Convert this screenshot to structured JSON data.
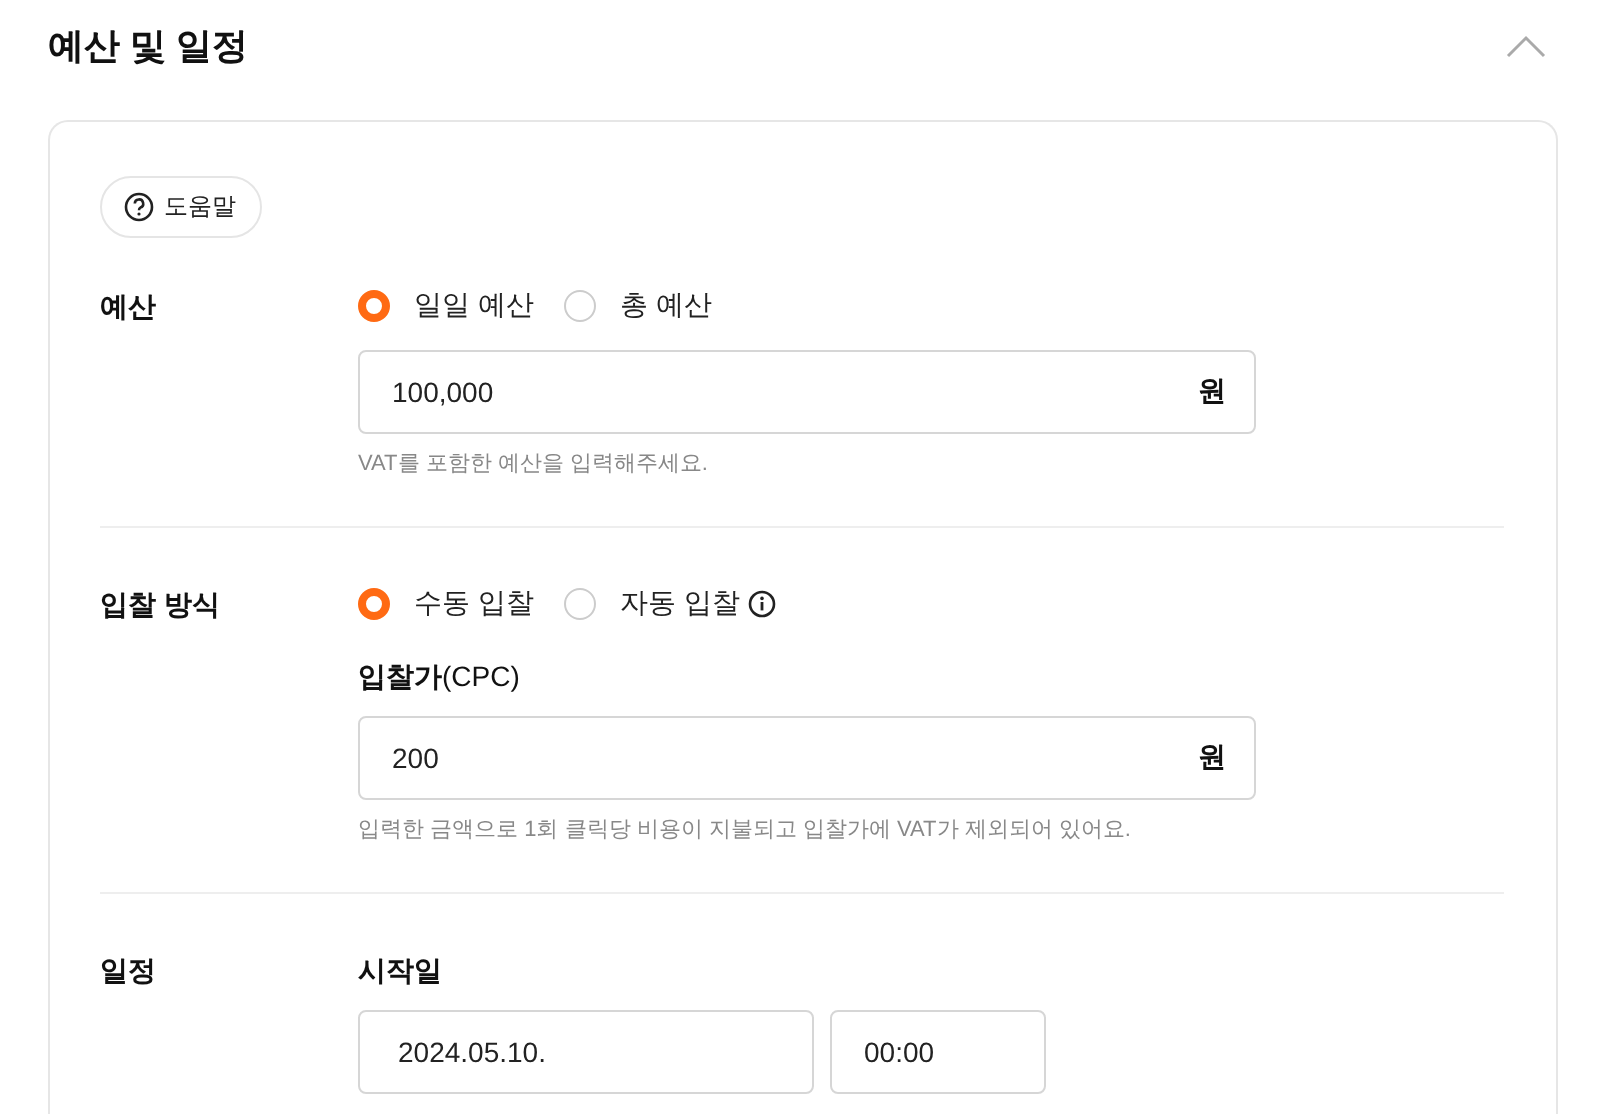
{
  "section": {
    "title": "예산 및 일정",
    "expanded": true
  },
  "help_button": {
    "label": "도움말"
  },
  "budget": {
    "label": "예산",
    "options": [
      {
        "label": "일일 예산",
        "selected": true
      },
      {
        "label": "총 예산",
        "selected": false
      }
    ],
    "value": "100,000",
    "unit": "원",
    "hint": "VAT를 포함한 예산을 입력해주세요."
  },
  "bidding": {
    "label": "입찰 방식",
    "options": [
      {
        "label": "수동 입찰",
        "selected": true,
        "info": false
      },
      {
        "label": "자동 입찰",
        "selected": false,
        "info": true
      }
    ],
    "field_label": "**입찰가**(CPC)",
    "value": "200",
    "unit": "원",
    "hint": "입력한 금액으로 1회 클릭당 비용이 지불되고 입찰가에 VAT가 제외되어 있어요."
  },
  "schedule": {
    "label": "일정",
    "field_label": "시작일",
    "date": "2024.05.10.",
    "time": "00:00"
  }
}
